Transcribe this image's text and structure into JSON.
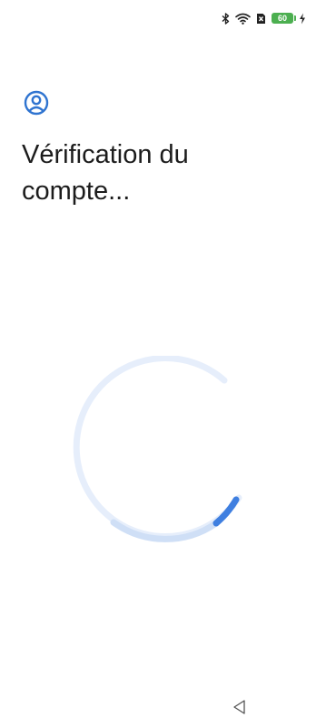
{
  "status_bar": {
    "icons": [
      "bluetooth-icon",
      "wifi-icon",
      "sim-icon",
      "battery-icon",
      "charging-icon"
    ],
    "battery_level": "60",
    "battery_color": "#4caf50"
  },
  "header": {
    "icon": "account-icon",
    "title": "Vérification du compte..."
  },
  "progress": {
    "state": "indeterminate",
    "accent_color": "#3f7fe0",
    "track_color": "#e6eefb"
  },
  "nav_bar": {
    "back_icon": "back-triangle-icon"
  }
}
